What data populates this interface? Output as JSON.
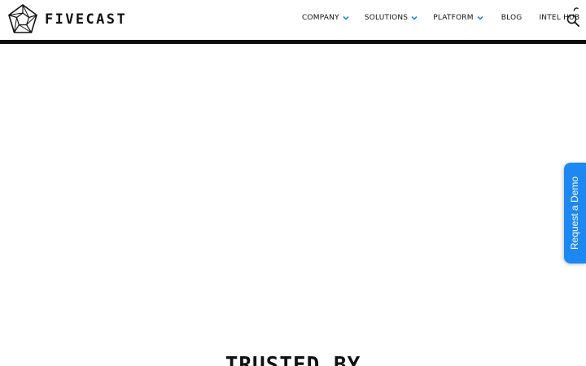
{
  "header": {
    "logo_text": "FIVECAST",
    "nav": [
      {
        "label": "COMPANY",
        "has_dropdown": true
      },
      {
        "label": "SOLUTIONS",
        "has_dropdown": true
      },
      {
        "label": "PLATFORM",
        "has_dropdown": true
      },
      {
        "label": "BLOG",
        "has_dropdown": false
      },
      {
        "label": "INTEL HUB",
        "has_dropdown": false
      }
    ],
    "icons": {
      "search": "search-icon",
      "chevron": "chevron-down-icon",
      "loading": "loading-spinner-icon"
    },
    "chevron_color": "#1e88f2"
  },
  "demo_tab": {
    "label": "Request a Demo",
    "color": "#1e88f2"
  },
  "main": {
    "section_heading": "TRUSTED BY"
  }
}
